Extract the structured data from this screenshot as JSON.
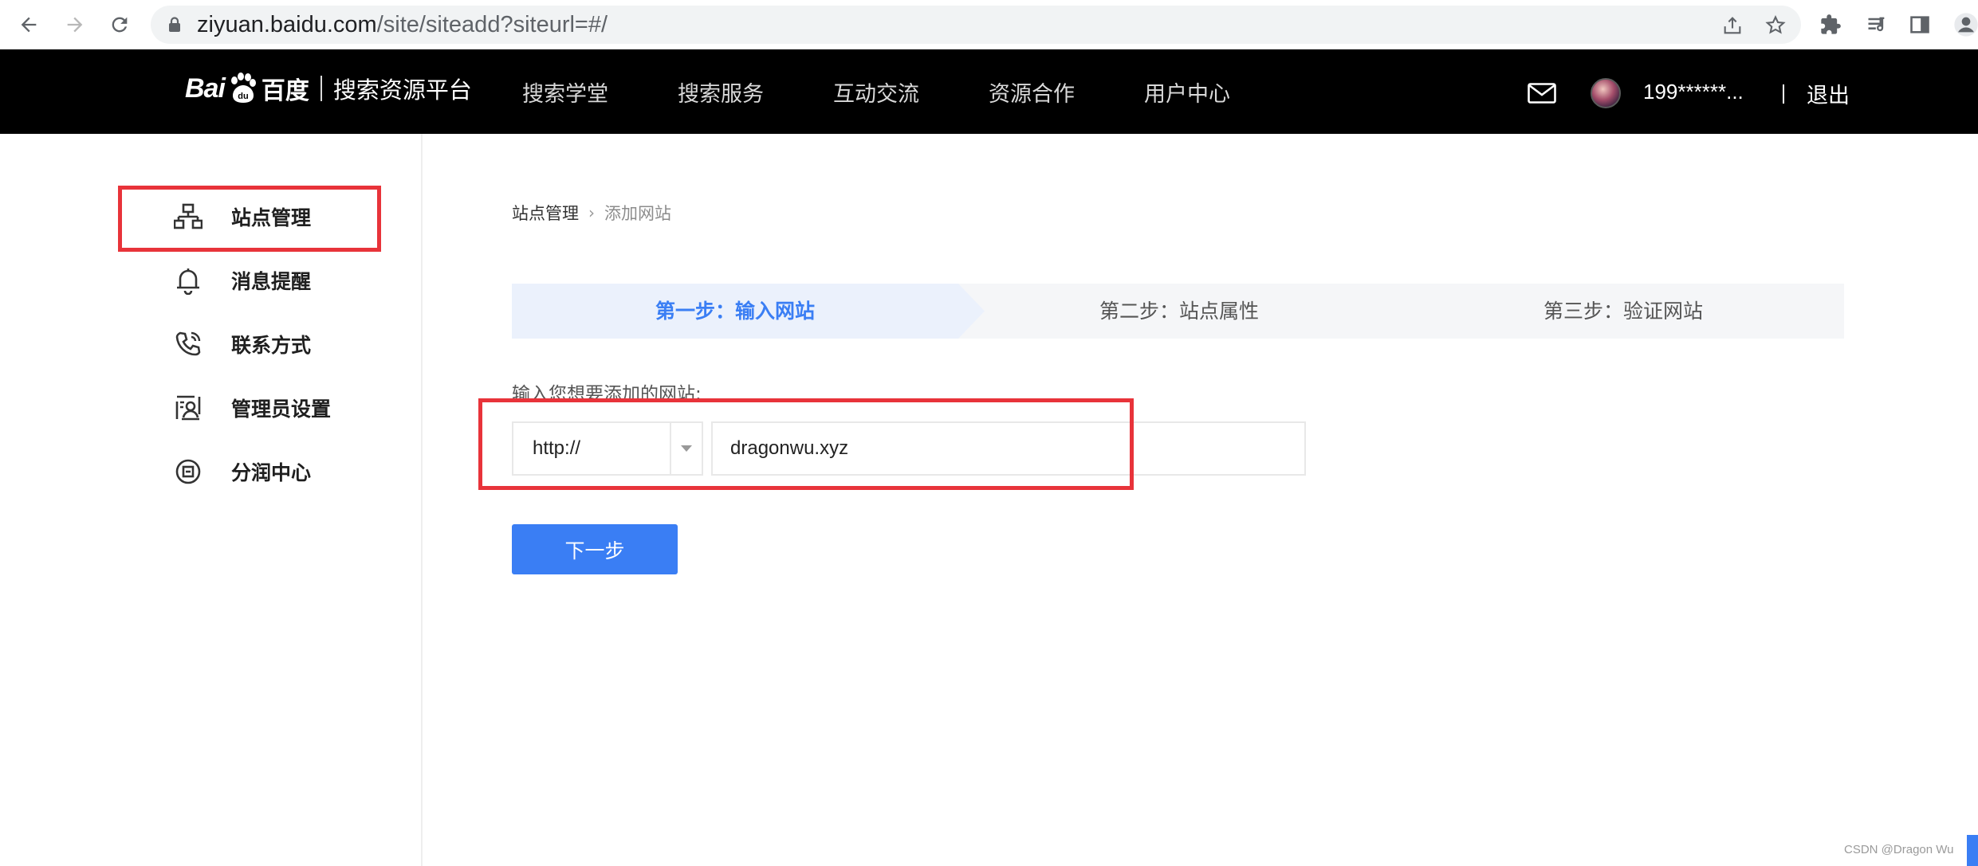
{
  "browser": {
    "url_host": "ziyuan.baidu.com",
    "url_path": "/site/siteadd?siteurl=#/",
    "icons": [
      "back-icon",
      "forward-icon",
      "reload-icon",
      "lock-icon",
      "share-icon",
      "star-icon",
      "extensions-icon",
      "media-icon",
      "sidepanel-icon",
      "profile-icon"
    ]
  },
  "header": {
    "logo_latin": "Bai",
    "logo_paw_text": "du",
    "logo_cn": "百度",
    "platform": "搜索资源平台",
    "nav": [
      "搜索学堂",
      "搜索服务",
      "互动交流",
      "资源合作",
      "用户中心"
    ],
    "username": "199******...",
    "logout": "退出"
  },
  "sidebar": {
    "items": [
      {
        "label": "站点管理",
        "icon": "sitemap-icon"
      },
      {
        "label": "消息提醒",
        "icon": "bell-icon"
      },
      {
        "label": "联系方式",
        "icon": "phone-icon"
      },
      {
        "label": "管理员设置",
        "icon": "admin-icon"
      },
      {
        "label": "分润中心",
        "icon": "revenue-icon"
      }
    ]
  },
  "main": {
    "breadcrumb": [
      "站点管理",
      "添加网站"
    ],
    "steps": [
      "第一步：输入网站",
      "第二步：站点属性",
      "第三步：验证网站"
    ],
    "active_step": 1,
    "field_label": "输入您想要添加的网站:",
    "protocol": "http://",
    "url_value": "dragonwu.xyz",
    "next_button": "下一步"
  },
  "watermark": "CSDN @Dragon   Wu",
  "colors": {
    "accent": "#3a7ef4",
    "annotation_red": "#e8333a",
    "header_bg": "#000000"
  }
}
